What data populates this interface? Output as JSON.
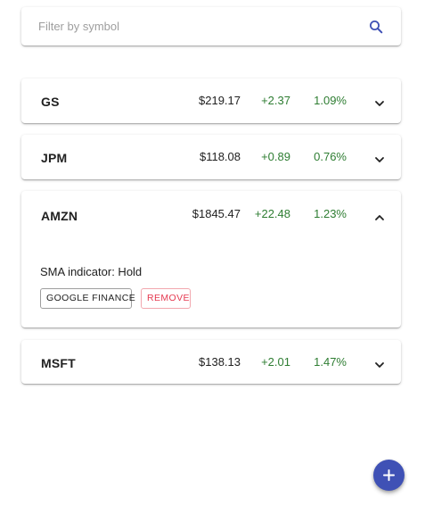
{
  "search": {
    "placeholder": "Filter by symbol",
    "value": ""
  },
  "stocks": [
    {
      "symbol": "GS",
      "price": "$219.17",
      "change": "+2.37",
      "percent": "1.09%",
      "expanded": false
    },
    {
      "symbol": "JPM",
      "price": "$118.08",
      "change": "+0.89",
      "percent": "0.76%",
      "expanded": false
    },
    {
      "symbol": "AMZN",
      "price": "$1845.47",
      "change": "+22.48",
      "percent": "1.23%",
      "expanded": true,
      "details": {
        "sma_label": "SMA indicator: Hold",
        "google_finance_label": "GOOGLE FINANCE",
        "remove_label": "REMOVE"
      }
    },
    {
      "symbol": "MSFT",
      "price": "$138.13",
      "change": "+2.01",
      "percent": "1.47%",
      "expanded": false
    }
  ],
  "colors": {
    "positive": "#2e7d32",
    "accent": "#3f51b5",
    "remove": "#e53950"
  },
  "icons": {
    "search": "search-icon",
    "expand": "chevron-down-icon",
    "collapse": "chevron-up-icon",
    "add": "plus-icon"
  }
}
